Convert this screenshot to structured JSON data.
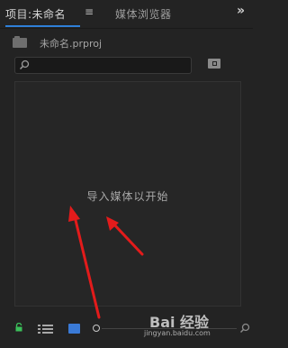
{
  "tabs": {
    "project_label": "项目:未命名",
    "menu_glyph": "≡",
    "media_browser_label": "媒体浏览器",
    "overflow_glyph": "»"
  },
  "project": {
    "file_name": "未命名.prproj"
  },
  "search": {
    "value": ""
  },
  "content": {
    "empty_message": "导入媒体以开始"
  },
  "watermark": {
    "brand": "Bai 经验",
    "url": "jingyan.baidu.com"
  },
  "colors": {
    "accent_blue": "#2f7fd8",
    "lock_green": "#3bbf5a",
    "annotation_red": "#e31b1b"
  },
  "icons": [
    "folder-icon",
    "search-icon",
    "new-bin-icon",
    "lock-icon",
    "list-view-icon",
    "icon-view-icon",
    "zoom-slider-handle",
    "find-icon"
  ]
}
